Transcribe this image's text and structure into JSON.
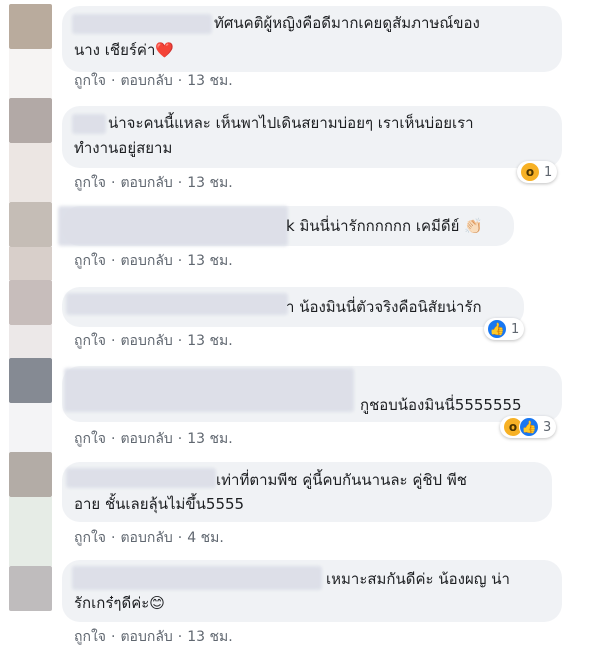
{
  "comments": [
    {
      "text_lines": [
        "ทัศนคติผู้หญิงคือดีมากเคยดูสัมภาษณ์ของ",
        "นาง เชียร์ค่า❤️"
      ],
      "like": "ถูกใจ",
      "reply": "ตอบกลับ",
      "time": "13 ชม.",
      "avatar_color": "#b9ab9d"
    },
    {
      "text_lines": [
        "น่าจะคนนี้แหละ เห็นพาไปเดินสยามบ่อยๆ เราเห็นบ่อยเรา",
        "ทำงานอยู่สยาม"
      ],
      "like": "ถูกใจ",
      "reply": "ตอบกลับ",
      "time": "13 ชม.",
      "avatar_color": "#b2a9a6",
      "reaction": {
        "icons": [
          "wow-icon"
        ],
        "count": "1"
      }
    },
    {
      "text_lines": [
        "k มินนี่น่ารักกกกกก เคมีดีย์ 👏🏻"
      ],
      "like": "ถูกใจ",
      "reply": "ตอบกลับ",
      "time": "13 ชม.",
      "avatar_color": "#c5bdb6"
    },
    {
      "text_lines": [
        "า น้องมินนี่ตัวจริงคือนิสัยน่ารัก"
      ],
      "like": "ถูกใจ",
      "reply": "ตอบกลับ",
      "time": "13 ชม.",
      "avatar_color": "#c7bdbb",
      "reaction": {
        "icons": [
          "like-icon"
        ],
        "count": "1"
      }
    },
    {
      "text_lines": [
        "กูชอบน้องมินนี่5555555"
      ],
      "like": "ถูกใจ",
      "reply": "ตอบกลับ",
      "time": "13 ชม.",
      "avatar_color": "#858a93",
      "reaction": {
        "icons": [
          "wow-icon",
          "like-icon"
        ],
        "count": "3"
      }
    },
    {
      "text_lines": [
        "เท่าที่ตามพีช คู่นี้คบกันนานละ คู่ชิป พีช",
        "อาย ชั้นเลยลุ้นไม่ขึ้น5555"
      ],
      "like": "ถูกใจ",
      "reply": "ตอบกลับ",
      "time": "4 ชม.",
      "avatar_color": "#b3aca6"
    },
    {
      "text_lines": [
        "เหมาะสมกันดีค่ะ น้องผญ น่า",
        "รักเกร๋ๆดีค่ะ😊"
      ],
      "like": "ถูกใจ",
      "reply": "ตอบกลับ",
      "time": "13 ชม.",
      "avatar_color": "#bfbcbd"
    }
  ]
}
